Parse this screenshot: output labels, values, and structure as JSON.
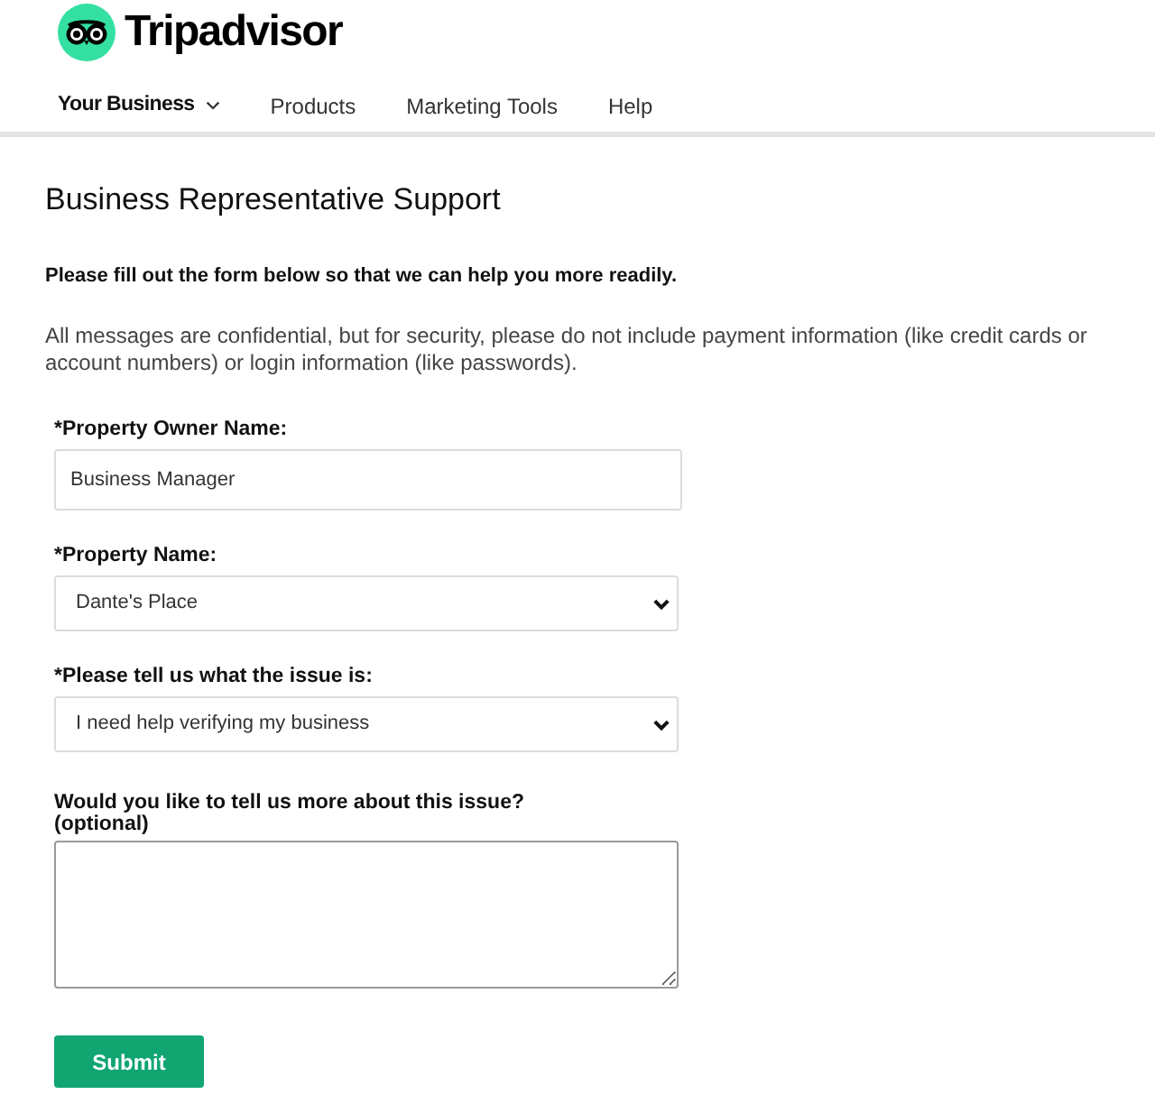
{
  "header": {
    "logo_text": "Tripadvisor"
  },
  "nav": [
    {
      "label": "Your Business",
      "kind": "dropdown",
      "selected": true
    },
    {
      "label": "Products",
      "kind": "link",
      "selected": false
    },
    {
      "label": "Marketing Tools",
      "kind": "link",
      "selected": false
    },
    {
      "label": "Help",
      "kind": "link",
      "selected": false
    }
  ],
  "page": {
    "title": "Business Representative Support",
    "intro": "Please fill out the form below so that we can help you more readily.",
    "notice": "All messages are confidential, but for security, please do not include payment information (like credit cards or account numbers) or login information (like passwords)."
  },
  "form": {
    "fields": [
      {
        "kind": "text",
        "label": "*Property Owner Name:",
        "value": "Business Manager"
      },
      {
        "kind": "select",
        "label": "*Property Name:",
        "value": "Dante's Place"
      },
      {
        "kind": "select",
        "label": "*Please tell us what the issue is:",
        "value": "I need help verifying my business"
      },
      {
        "kind": "textarea",
        "label": "Would you like to tell us more about this issue?",
        "note": "(optional)"
      }
    ],
    "submit": "Submit"
  }
}
